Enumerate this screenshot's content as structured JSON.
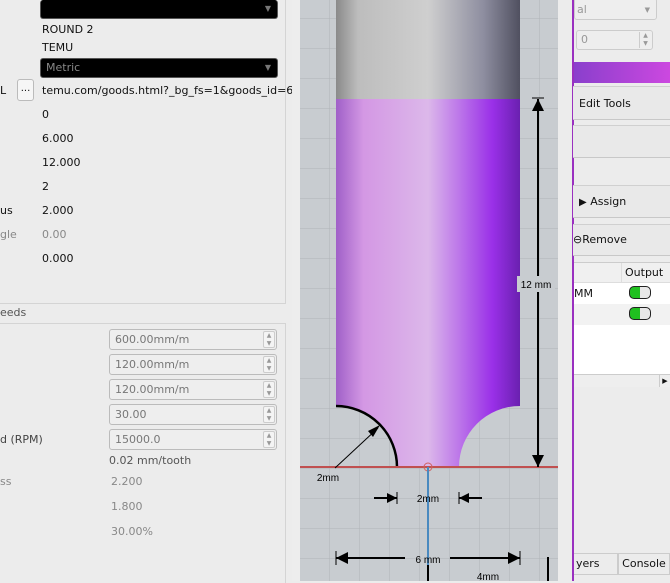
{
  "tool_form": {
    "top_combo": "",
    "name": "ROUND 2",
    "brand": "TEMU",
    "units": "Metric",
    "url_label_fragment": "L",
    "url_browse_button": "...",
    "url": "temu.com/goods.html?_bg_fs=1&goods_id=6",
    "number": "0",
    "diameter": "6.000",
    "length": "12.000",
    "flutes": "2",
    "radius_label_fragment": "us",
    "radius": "2.000",
    "angle_label_fragment": "gle",
    "angle": "0.00",
    "last_value": "0.000"
  },
  "feeds": {
    "section_label": "eeds",
    "feed_rate": "600.00mm/m",
    "plunge_rate": "120.00mm/m",
    "ramp_rate": "120.00mm/m",
    "field4": "30.00",
    "spindle_label_fragment": "d (RPM)",
    "spindle_speed": "15000.0",
    "chip_load": "0.02 mm/tooth",
    "pass_label_fragment": "ss",
    "depth_per_pass": "2.200",
    "value2": "1.800",
    "stepover": "30.00%"
  },
  "diagram": {
    "radius_dim": "2mm",
    "tip_dim": "2mm",
    "length_dim": "12 mm",
    "diameter_dim": "6 mm",
    "half_dim": "4mm",
    "colors": {
      "shank": "#c8c8c8",
      "flute": "#c070e0",
      "cut_line": "#c05050",
      "axis": "#4a8ac0",
      "grid_bg": "#c8ccd0"
    }
  },
  "right_panel": {
    "combo": "al",
    "spin": "0",
    "edit_tools": "Edit Tools",
    "assign": "Assign",
    "remove": "Remove",
    "table_header_output": "Output",
    "rows": [
      {
        "name": "MM",
        "output": true
      },
      {
        "name": "",
        "output": true
      }
    ],
    "tabs": [
      "yers",
      "Console"
    ]
  }
}
